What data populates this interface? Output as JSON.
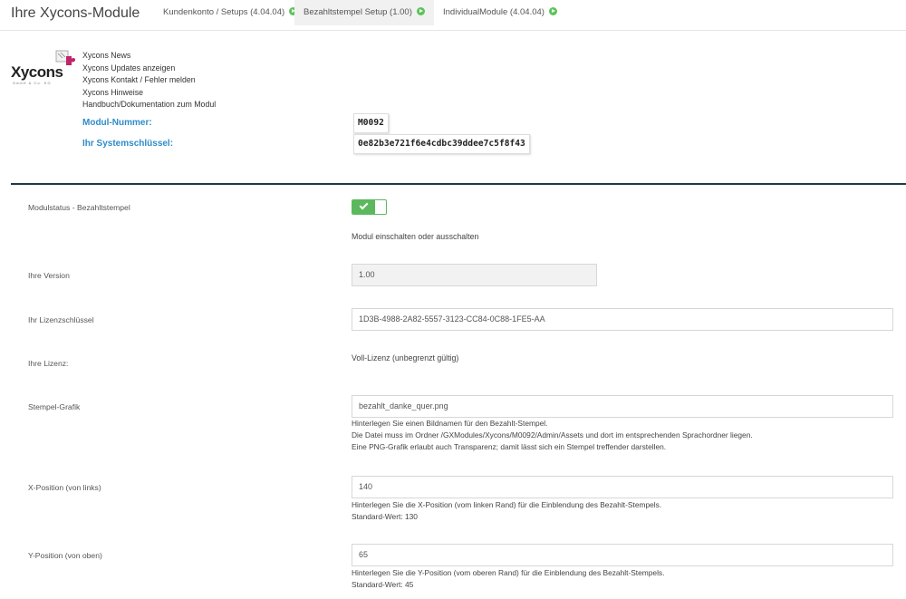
{
  "header": {
    "title": "Ihre Xycons-Module",
    "tabs": [
      {
        "label": "Kundenkonto / Setups (4.04.04)",
        "active": false
      },
      {
        "label": "Bezahltstempel Setup (1.00)",
        "active": true
      },
      {
        "label": "IndividualModule (4.04.04)",
        "active": false
      }
    ]
  },
  "logo": {
    "word": "Xycons",
    "sub": "GmbH & Co. KG"
  },
  "links": [
    "Xycons News",
    "Xycons Updates anzeigen",
    "Xycons Kontakt / Fehler melden",
    "Xycons Hinweise",
    "Handbuch/Dokumentation zum Modul"
  ],
  "module": {
    "number_label": "Modul-Nummer:",
    "number": "M0092",
    "key_label": "Ihr Systemschlüssel:",
    "key": "0e82b3e721f6e4cdbc39ddee7c5f8f43"
  },
  "form": {
    "status_label": "Modulstatus - Bezahltstempel",
    "status_on": true,
    "status_hint": "Modul einschalten oder ausschalten",
    "version_label": "Ihre Version",
    "version": "1.00",
    "license_key_label": "Ihr Lizenzschlüssel",
    "license_key": "1D3B-4988-2A82-5557-3123-CC84-0C88-1FE5-AA",
    "license_label": "Ihre Lizenz:",
    "license": "Voll-Lizenz (unbegrenzt gültig)",
    "stamp_label": "Stempel-Grafik",
    "stamp_value": "bezahlt_danke_quer.png",
    "stamp_hint_1": "Hinterlegen Sie einen Bildnamen für den Bezahlt-Stempel.",
    "stamp_hint_2": "Die Datei muss im Ordner /GXModules/Xycons/M0092/Admin/Assets und dort im entsprechenden Sprachordner liegen.",
    "stamp_hint_3": "Eine PNG-Grafik erlaubt auch Transparenz; damit lässt sich ein Stempel treffender darstellen.",
    "x_label": "X-Position (von links)",
    "x_value": "140",
    "x_hint_1": "Hinterlegen Sie die X-Position (vom linken Rand) für die Einblendung des Bezahlt-Stempels.",
    "x_hint_2": "Standard-Wert: 130",
    "y_label": "Y-Position (von oben)",
    "y_value": "65",
    "y_hint_1": "Hinterlegen Sie die Y-Position (vom oberen Rand) für die Einblendung des Bezahlt-Stempels.",
    "y_hint_2": "Standard-Wert: 45"
  },
  "colors": {
    "accent": "#2e8cc8",
    "success": "#5cb85c",
    "divider": "#1f3a44"
  }
}
